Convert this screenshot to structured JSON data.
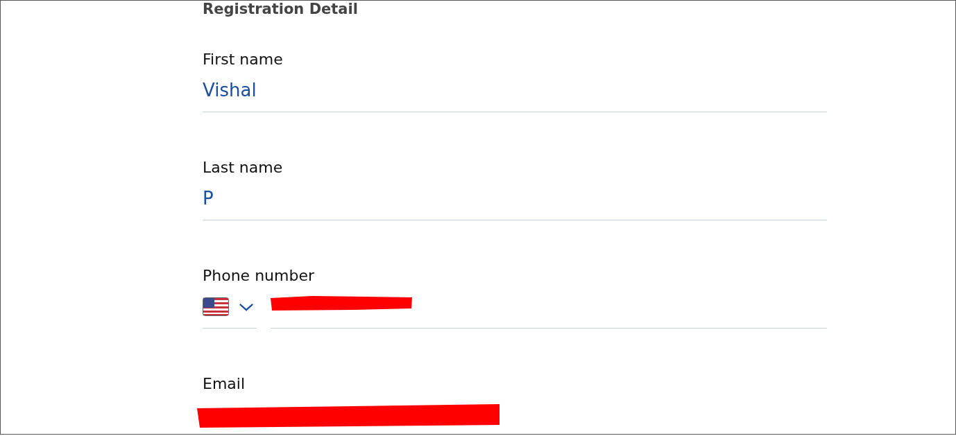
{
  "heading": "Registration Detail",
  "fields": [
    {
      "kind": "text",
      "label": "First name",
      "value": "Vishal"
    },
    {
      "kind": "text",
      "label": "Last name",
      "value": "P"
    },
    {
      "kind": "phone",
      "label": "Phone number",
      "redacted": true
    },
    {
      "kind": "email",
      "label": "Email",
      "redacted": true
    }
  ]
}
